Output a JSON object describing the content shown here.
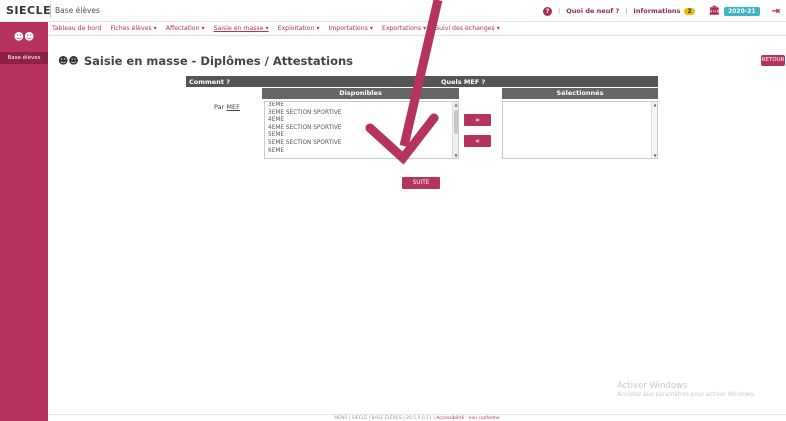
{
  "header": {
    "brand": "SIECLE",
    "module": "Base élèves",
    "help_icon": "question-circle-icon",
    "links": [
      "Quoi de neuf ?",
      "Informations"
    ],
    "info_count": "2",
    "year": "2020-21"
  },
  "sidebar": {
    "item_label": "Base élèves"
  },
  "nav": {
    "items": [
      "Tableau de bord",
      "Fiches élèves ▾",
      "Affectation ▾",
      "Saisie en masse ▾",
      "Exploitation ▾",
      "Importations ▾",
      "Exportations ▾",
      "Suivi des échanges ▾"
    ]
  },
  "page": {
    "title": "Saisie en masse - Diplômes / Attestations",
    "retour": "RETOUR"
  },
  "form": {
    "col_comment": "Comment ?",
    "col_quels": "Quels MEF ?",
    "col_disponibles": "Disponibles",
    "col_selectionnes": "Sélectionnés",
    "par_label": "Par",
    "par_link": "MEF",
    "options": [
      "3EME",
      "3EME SECTION SPORTIVE",
      "4EME",
      "4EME SECTION SPORTIVE",
      "5EME",
      "5EME SECTION SPORTIVE",
      "6EME"
    ],
    "move_right": "»",
    "move_left": "«",
    "suite": "SUITE"
  },
  "footer": {
    "text": "MENS | SIECLE | BASE ÉLÈVES | 20.5.0.0.11 |",
    "accessibility": "Accessibilité : non conforme"
  },
  "watermark": {
    "line1": "Activer Windows",
    "line2": "Accédez aux paramètres pour activer Windows."
  },
  "colors": {
    "accent": "#b5335e",
    "header_dark": "#555555",
    "annotation_arrow": "#b5335e"
  }
}
